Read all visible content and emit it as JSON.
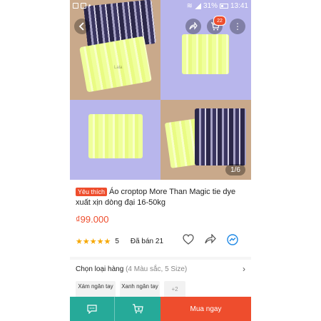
{
  "status_bar": {
    "battery": "31%",
    "time": "13:41"
  },
  "gallery": {
    "counter": "1/6",
    "cart_count": "22",
    "watermark": "Lala"
  },
  "product": {
    "favorite_badge": "Yêu thích",
    "title": "Áo croptop More Than Magic tie dye xuất xịn dòng đại 16-50kg",
    "price": "₫99.000",
    "rating_stars": "★★★★★",
    "rating_value": "5",
    "sold": "Đã bán 21"
  },
  "variation": {
    "title": "Chọn loại hàng",
    "subtitle": "(4 Màu sắc, 5 Size)",
    "options": [
      "Xám ngân tay",
      "Xanh ngân tay"
    ],
    "more": "+2"
  },
  "bottom_bar": {
    "buy_label": "Mua ngay"
  },
  "colors": {
    "brand": "#ee4d2d",
    "teal": "#26aa99",
    "star": "#f6a700"
  }
}
